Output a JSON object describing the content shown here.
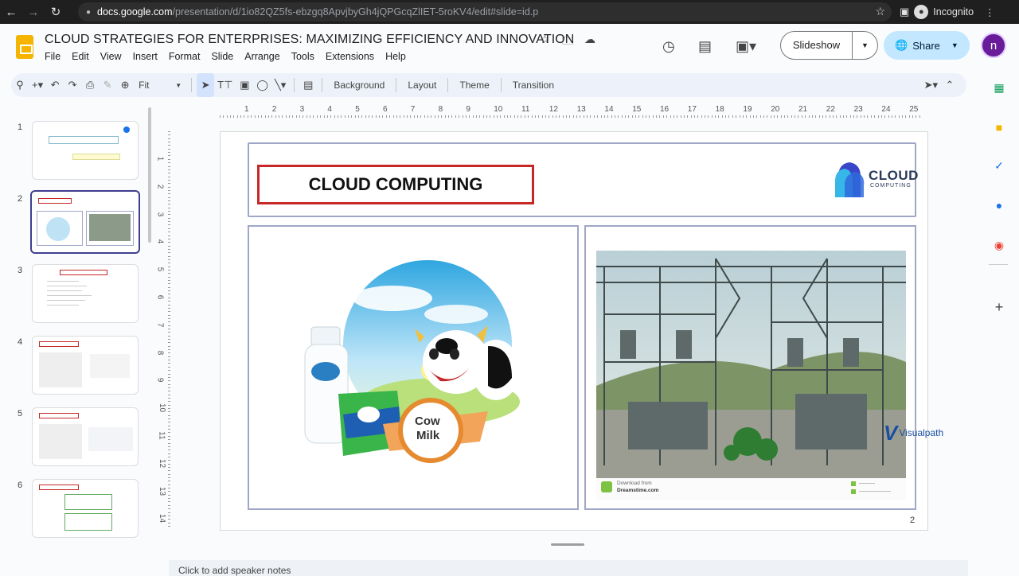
{
  "browser": {
    "url_domain": "docs.google.com",
    "url_path": "/presentation/d/1io82QZ5fs-ebzgq8ApvjbyGh4jQPGcqZlIET-5roKV4/edit#slide=id.p",
    "incognito_label": "Incognito"
  },
  "app": {
    "doc_title": "CLOUD STRATEGIES FOR ENTERPRISES: MAXIMIZING EFFICIENCY AND INNOVATION",
    "menu": [
      "File",
      "Edit",
      "View",
      "Insert",
      "Format",
      "Slide",
      "Arrange",
      "Tools",
      "Extensions",
      "Help"
    ],
    "slideshow_label": "Slideshow",
    "share_label": "Share",
    "avatar_letter": "n"
  },
  "toolbar": {
    "zoom_value": "Fit",
    "background_label": "Background",
    "layout_label": "Layout",
    "theme_label": "Theme",
    "transition_label": "Transition"
  },
  "filmstrip": {
    "numbers": [
      "1",
      "2",
      "3",
      "4",
      "5",
      "6"
    ],
    "selected": 2
  },
  "ruler": {
    "h_ticks": [
      "1",
      "2",
      "3",
      "4",
      "5",
      "6",
      "7",
      "8",
      "9",
      "10",
      "11",
      "12",
      "13",
      "14",
      "15",
      "16",
      "17",
      "18",
      "19",
      "20",
      "21",
      "22",
      "23",
      "24",
      "25"
    ],
    "v_ticks": [
      "1",
      "2",
      "3",
      "4",
      "5",
      "6",
      "7",
      "8",
      "9",
      "10",
      "11",
      "12",
      "13",
      "14"
    ]
  },
  "slide": {
    "title": "CLOUD COMPUTING",
    "logo_text_main": "CLOUD",
    "logo_text_sub": "COMPUTING",
    "milk_badge_line1": "Cow",
    "milk_badge_line2": "Milk",
    "photo_caption_line1": "Download from",
    "photo_caption_line2": "Dreamstime.com",
    "page_number": "2"
  },
  "watermark": {
    "text": "Visualpath"
  },
  "notes": {
    "placeholder": "Click to add speaker notes"
  },
  "colors": {
    "title_border": "#c62828",
    "panel_border": "#9fa6c8",
    "share_bg": "#c2e7ff",
    "selected_thumb_border": "#3f3d8f"
  }
}
